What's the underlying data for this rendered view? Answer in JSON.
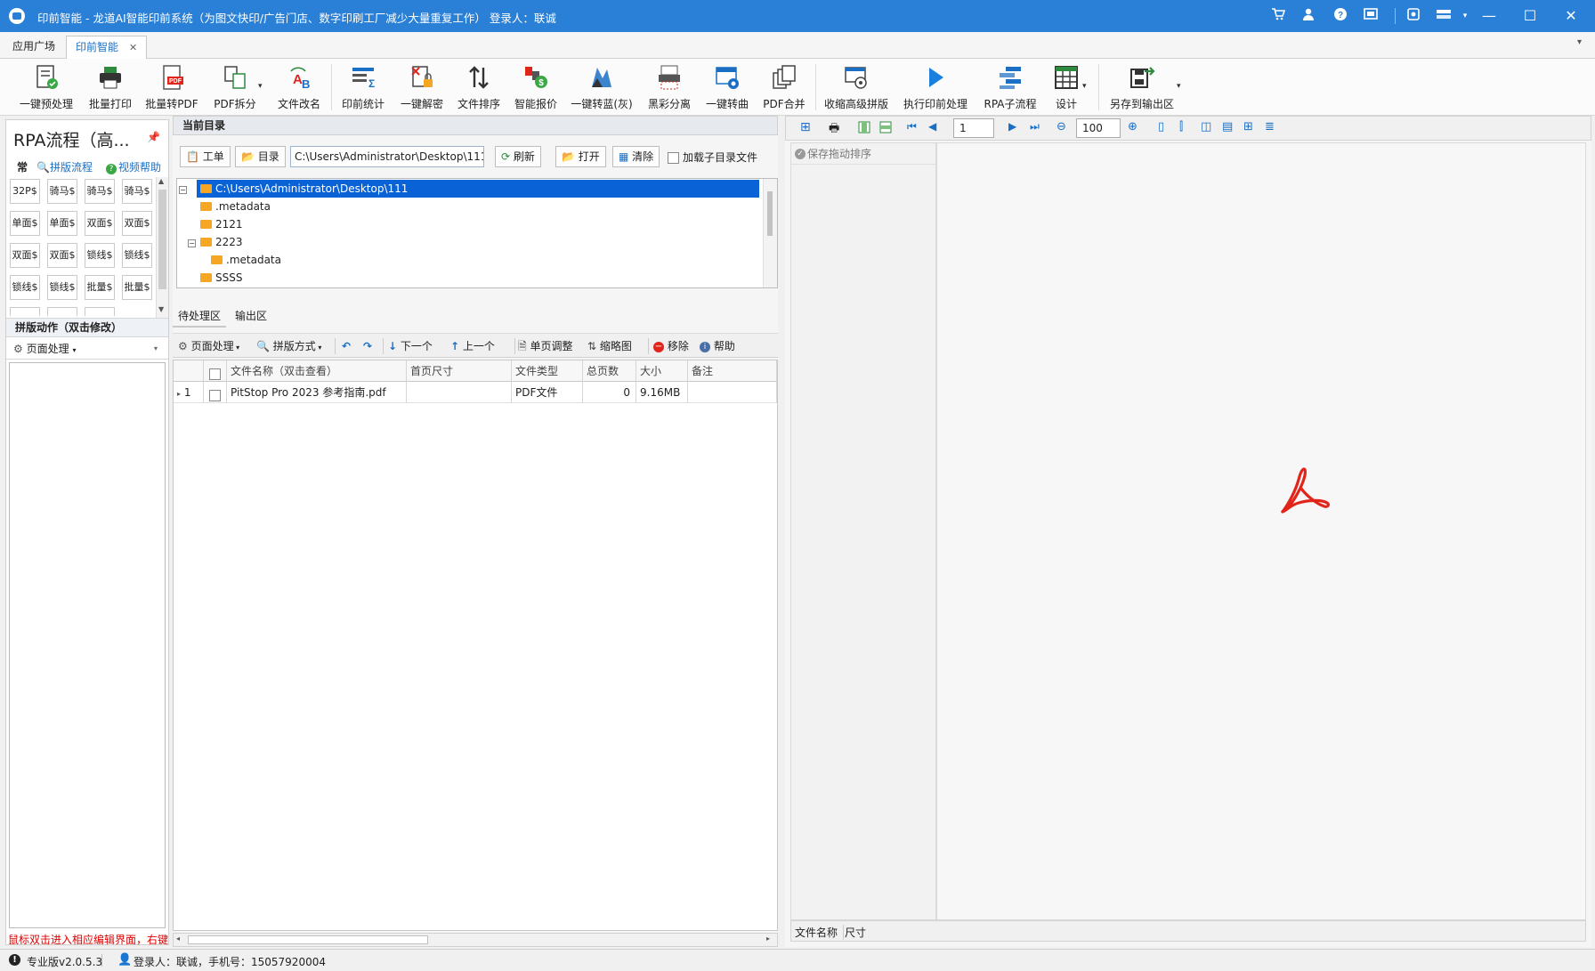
{
  "window": {
    "title": "印前智能 - 龙道AI智能印前系统（为图文快印/广告门店、数字印刷工厂减少大量重复工作）  登录人：联诚"
  },
  "tabs": [
    {
      "label": "应用广场"
    },
    {
      "label": "印前智能"
    }
  ],
  "ribbon": [
    {
      "label": "一键预处理",
      "icon": "preprocess-icon"
    },
    {
      "label": "批量打印",
      "icon": "printer-icon"
    },
    {
      "label": "批量转PDF",
      "icon": "pdf-convert-icon"
    },
    {
      "label": "PDF拆分",
      "icon": "pdf-split-icon"
    },
    {
      "label": "文件改名",
      "icon": "rename-icon"
    },
    {
      "label": "印前统计",
      "icon": "statistics-icon"
    },
    {
      "label": "一键解密",
      "icon": "decrypt-icon"
    },
    {
      "label": "文件排序",
      "icon": "sort-icon"
    },
    {
      "label": "智能报价",
      "icon": "quote-icon"
    },
    {
      "label": "一键转蓝(灰)",
      "icon": "convert-blue-icon"
    },
    {
      "label": "黑彩分离",
      "icon": "color-separate-icon"
    },
    {
      "label": "一键转曲",
      "icon": "outline-icon"
    },
    {
      "label": "PDF合并",
      "icon": "pdf-merge-icon"
    },
    {
      "label": "收缩高级拼版",
      "icon": "imposition-icon"
    },
    {
      "label": "执行印前处理",
      "icon": "play-icon"
    },
    {
      "label": "RPA子流程",
      "icon": "rpa-icon"
    },
    {
      "label": "设计",
      "icon": "design-grid-icon"
    },
    {
      "label": "另存到输出区",
      "icon": "save-output-icon"
    }
  ],
  "left": {
    "title": "RPA流程（高...",
    "sub_common": "常",
    "sub_flow": "拼版流程",
    "sub_help": "视频帮助",
    "grid": [
      "32P$",
      "骑马$",
      "骑马$",
      "骑马$",
      "单面$",
      "单面$",
      "双面$",
      "双面$",
      "双面$",
      "双面$",
      "锁线$",
      "锁线$",
      "锁线$",
      "锁线$",
      "批量$",
      "批量$"
    ],
    "section": "拼版动作（双击修改）",
    "page_process": "页面处理",
    "hint": "鼠标双击进入相应编辑界面，右键"
  },
  "middle": {
    "header": "当前目录",
    "btn_order": "工单",
    "btn_dir": "目录",
    "path": "C:\\Users\\Administrator\\Desktop\\111",
    "btn_refresh": "刷新",
    "btn_open": "打开",
    "btn_clear": "清除",
    "load_sub": "加载子目录文件",
    "tree": [
      {
        "label": "C:\\Users\\Administrator\\Desktop\\111"
      },
      {
        "label": ".metadata"
      },
      {
        "label": "2121"
      },
      {
        "label": "2223"
      },
      {
        "label": ".metadata"
      },
      {
        "label": "SSSS"
      }
    ],
    "tab_pending": "待处理区",
    "tab_output": "输出区",
    "tools": {
      "page_process": "页面处理",
      "impose_mode": "拼版方式",
      "next": "下一个",
      "prev": "上一个",
      "single_adjust": "单页调整",
      "thumbnail": "缩略图",
      "remove": "移除",
      "help": "帮助"
    },
    "columns": [
      "文件名称（双击查看）",
      "首页尺寸",
      "文件类型",
      "总页数",
      "大小",
      "备注"
    ],
    "rows": [
      {
        "index": "1",
        "name": "PitStop Pro 2023 参考指南.pdf",
        "size_first": "",
        "type": "PDF文件",
        "pages": "0",
        "size": "9.16MB",
        "note": ""
      }
    ]
  },
  "right": {
    "page_num": "1",
    "zoom": "100",
    "save_sort": "保存拖动排序",
    "foot_name": "文件名称",
    "foot_size": "尺寸"
  },
  "status": {
    "version": "专业版v2.0.5.3",
    "login": "登录人：联诚，手机号：15057920004"
  },
  "colors": {
    "title_bar": "#2a7fd6",
    "selection": "#0a63d6",
    "acrobat_red": "#e1251b",
    "hint_red": "#e00000"
  }
}
